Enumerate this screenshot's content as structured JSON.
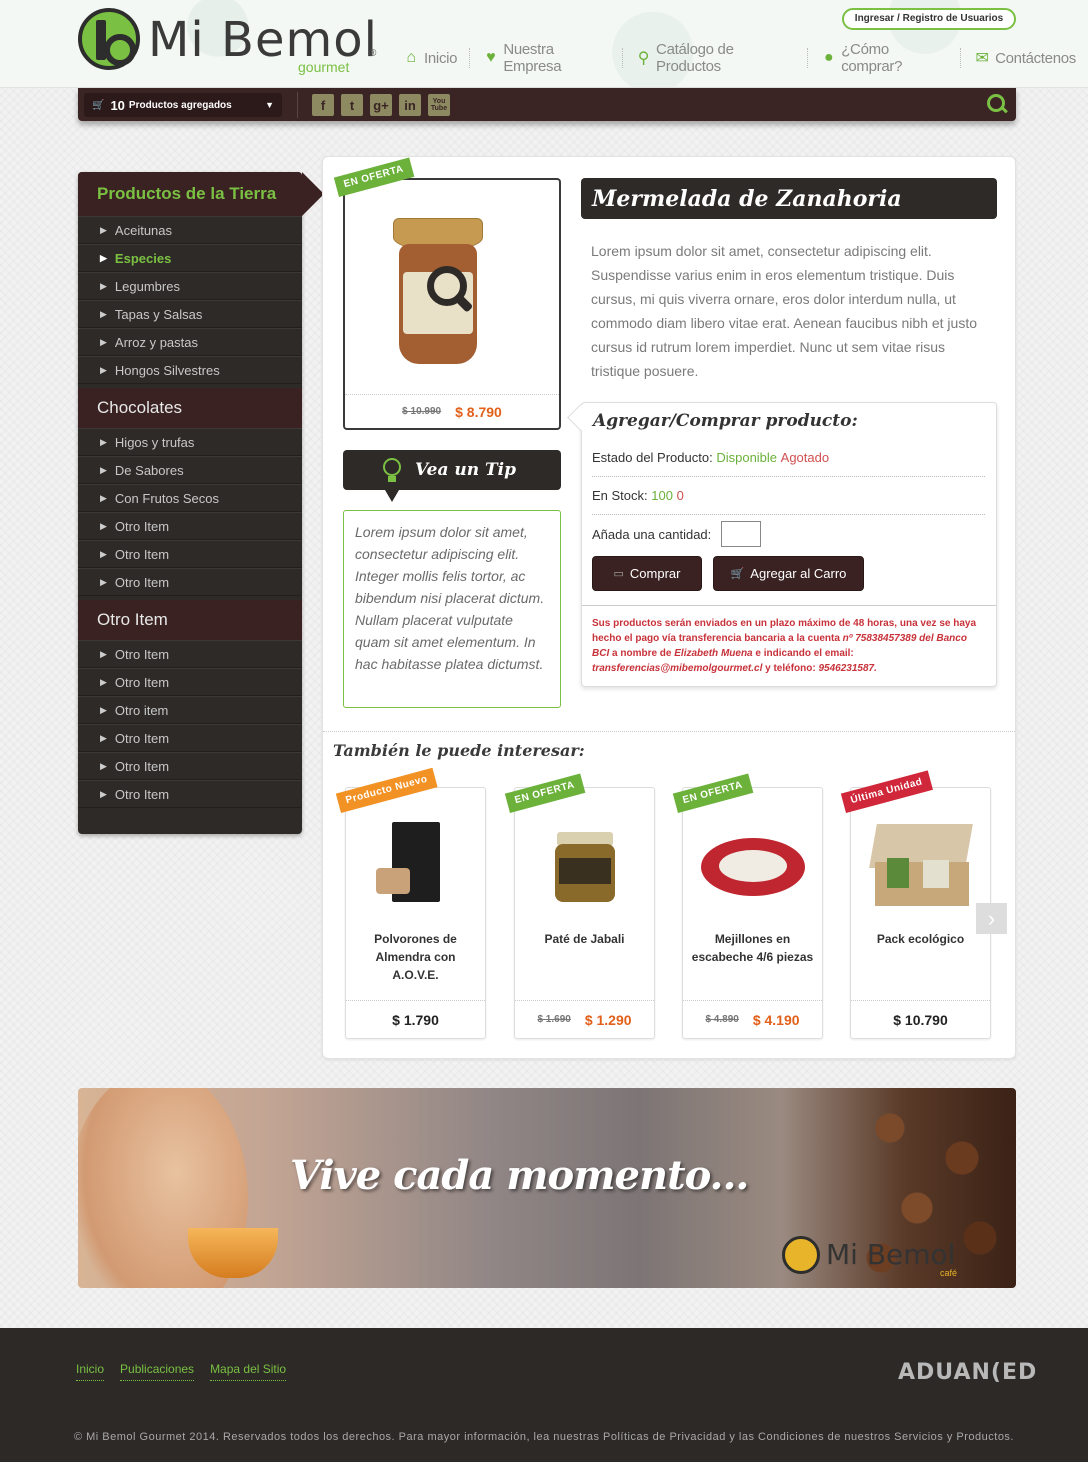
{
  "header": {
    "logo_text": "Mi Bemol",
    "logo_sub": "gourmet",
    "logo_reg": "®",
    "login_label": "Ingresar / Registro de Usuarios",
    "nav": [
      {
        "label": "Inicio",
        "icon": "home-icon"
      },
      {
        "label": "Nuestra Empresa",
        "icon": "heart-icon"
      },
      {
        "label": "Catálogo de Productos",
        "icon": "search-icon"
      },
      {
        "label": "¿Cómo comprar?",
        "icon": "bulb-icon"
      },
      {
        "label": "Contáctenos",
        "icon": "mail-icon"
      }
    ]
  },
  "toolbar": {
    "cart_count": "10",
    "cart_label": "Productos agregados",
    "social": [
      "f",
      "t",
      "g+",
      "in",
      "You Tube"
    ]
  },
  "sidebar": {
    "groups": [
      {
        "title": "Productos de la Tierra",
        "items": [
          "Aceitunas",
          "Especies",
          "Legumbres",
          "Tapas y Salsas",
          "Arroz y pastas",
          "Hongos Silvestres"
        ]
      },
      {
        "title": "Chocolates",
        "items": [
          "Higos y trufas",
          "De Sabores",
          "Con Frutos Secos",
          "Otro Item",
          "Otro Item",
          "Otro Item"
        ]
      },
      {
        "title": "Otro Item",
        "items": [
          "Otro Item",
          "Otro Item",
          "Otro item",
          "Otro Item",
          "Otro Item",
          "Otro Item"
        ]
      }
    ],
    "active_item": "Especies"
  },
  "product": {
    "badge": "EN OFERTA",
    "old_price": "$ 10.990",
    "new_price": "$ 8.790",
    "title": "Mermelada de Zanahoria",
    "description": "Lorem ipsum dolor sit amet, consectetur adipiscing elit. Suspendisse varius enim in eros elementum tristique. Duis cursus, mi quis viverra ornare, eros dolor interdum nulla, ut commodo diam libero vitae erat. Aenean faucibus nibh et justo cursus id rutrum lorem imperdiet. Nunc ut sem vitae risus tristique posuere."
  },
  "buy": {
    "title": "Agregar/Comprar producto:",
    "status_label": "Estado del Producto:",
    "status_available": "Disponible",
    "status_out": "Agotado",
    "stock_label": "En Stock:",
    "stock_value": "100",
    "stock_zero": "0",
    "qty_label": "Añada una cantidad:",
    "buy_label": "Comprar",
    "cart_label": "Agregar al Carro",
    "note_1": "Sus productos serán enviados en un plazo máximo de 48 horas, una vez se haya hecho el pago vía transferencia bancaria a la cuenta",
    "note_account": "nº 75838457389 del Banco BCI",
    "note_2": "a nombre de",
    "note_name": "Elizabeth Muena",
    "note_3": "e indicando el email:",
    "note_email": "transferencias@mibemolgourmet.cl",
    "note_4": "y teléfono:",
    "note_phone": "9546231587."
  },
  "tip": {
    "title": "Vea un Tip",
    "text": "Lorem ipsum dolor sit amet, consectetur adipiscing elit. Integer mollis felis tortor, ac bibendum nisi placerat dictum. Nullam placerat vulputate quam sit amet elementum. In hac habitasse platea dictumst."
  },
  "related": {
    "title": "También le puede interesar:",
    "items": [
      {
        "badge": "Producto Nuevo",
        "name": "Polvorones de Almendra con A.O.V.E.",
        "price": "$ 1.790",
        "old_price": ""
      },
      {
        "badge": "EN OFERTA",
        "name": "Paté de Jabali",
        "price": "$ 1.290",
        "old_price": "$ 1.690"
      },
      {
        "badge": "EN OFERTA",
        "name": "Mejillones en escabeche 4/6 piezas",
        "price": "$ 4.190",
        "old_price": "$ 4.890"
      },
      {
        "badge": "Última Unidad",
        "name": "Pack ecológico",
        "price": "$ 10.790",
        "old_price": ""
      }
    ]
  },
  "banner": {
    "text": "Vive cada momento...",
    "logo_text": "Mi Bemol",
    "logo_sub": "café"
  },
  "footer": {
    "links": [
      "Inicio",
      "Publicaciones",
      "Mapa del Sitio"
    ],
    "brand": "ADUAN(ED",
    "copyright": "© Mi Bemol Gourmet 2014. Reservados todos los derechos. Para mayor información, lea nuestras Políticas de Privacidad y las Condiciones de nuestros Servicios y Productos."
  }
}
